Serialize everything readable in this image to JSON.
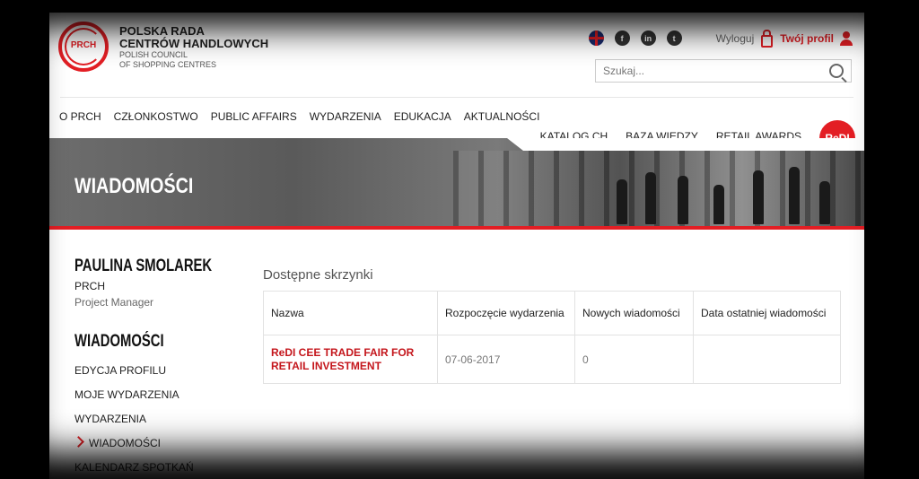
{
  "logo": {
    "mark_text": "PRCH",
    "line1": "POLSKA RADA",
    "line2": "CENTRÓW HANDLOWYCH",
    "line3": "POLISH COUNCIL",
    "line4": "OF SHOPPING CENTRES"
  },
  "header": {
    "logout_label": "Wyloguj",
    "profile_label": "Twój profil",
    "search_placeholder": "Szukaj..."
  },
  "nav": {
    "left": [
      "O PRCH",
      "CZŁONKOSTWO",
      "PUBLIC AFFAIRS",
      "WYDARZENIA",
      "EDUKACJA",
      "AKTUALNOŚCI"
    ],
    "right": [
      "KATALOG CH",
      "BAZA WIEDZY",
      "RETAIL AWARDS"
    ],
    "badge": "ReDI"
  },
  "banner": {
    "title": "WIADOMOŚCI"
  },
  "sidebar": {
    "name": "PAULINA SMOLAREK",
    "org": "PRCH",
    "role": "Project Manager",
    "heading": "WIADOMOŚCI",
    "items": [
      "EDYCJA PROFILU",
      "MOJE WYDARZENIA",
      "WYDARZENIA",
      "WIADOMOŚCI",
      "KALENDARZ SPOTKAŃ"
    ]
  },
  "main": {
    "heading": "Dostępne skrzynki",
    "columns": [
      "Nazwa",
      "Rozpoczęcie wydarzenia",
      "Nowych wiadomości",
      "Data ostatniej wiadomości"
    ],
    "rows": [
      {
        "name": "ReDI CEE TRADE FAIR FOR RETAIL INVESTMENT",
        "start": "07-06-2017",
        "new": "0",
        "last": ""
      }
    ]
  },
  "colors": {
    "accent": "#e31e24",
    "link": "#c4161c"
  }
}
